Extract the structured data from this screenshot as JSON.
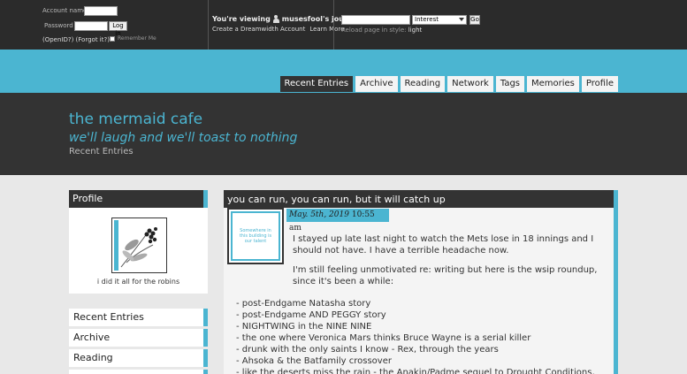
{
  "topbar": {
    "login": {
      "account_label": "Account name:",
      "password_label": "Password",
      "login_button": "Log in",
      "openid_link": "(OpenID?) (Forgot it?)",
      "remember_label": "Remember Me"
    },
    "viewing": {
      "prefix": "You're viewing",
      "journal": "musesfool's journal",
      "create_link": "Create a Dreamwidth Account",
      "learn_link": "Learn More"
    },
    "search": {
      "select_value": "Interest",
      "go_button": "Go",
      "reload_prefix": "Reload page in style:",
      "reload_style": "light"
    }
  },
  "tabs": [
    "Recent Entries",
    "Archive",
    "Reading",
    "Network",
    "Tags",
    "Memories",
    "Profile"
  ],
  "header": {
    "title": "the mermaid cafe",
    "subtitle": "we'll laugh and we'll toast to nothing",
    "page_name": "Recent Entries"
  },
  "sidebar": {
    "profile_heading": "Profile",
    "profile_caption": "i did it all for the robins",
    "nav": [
      "Recent Entries",
      "Archive",
      "Reading"
    ]
  },
  "entry": {
    "title": "you can run, you can run, but it will catch up",
    "date": "May. 5th, 2019",
    "time": "10:55 am",
    "userpic_text": "Somewhere in this building is our talent",
    "paragraphs": [
      "I stayed up late last night to watch the Mets lose in 18 innings and I",
      "should not have. I have a terrible headache now.",
      "I'm still feeling unmotivated re: writing but here is the wsip roundup,",
      "since it's been a while:"
    ],
    "list": [
      "- post-Endgame Natasha story",
      "- post-Endgame AND PEGGY story",
      "- NIGHTWING in the NINE NINE",
      "- the one where Veronica Mars thinks Bruce Wayne is a serial killer",
      "- drunk with the only saints I know - Rex, through the years",
      "- Ahsoka & the Batfamily crossover",
      "- like the deserts miss the rain - the Anakin/Padme sequel to Drought Conditions,"
    ]
  },
  "colors": {
    "accent": "#4bb5d1",
    "dark": "#333333",
    "background": "#e8e8e8"
  }
}
